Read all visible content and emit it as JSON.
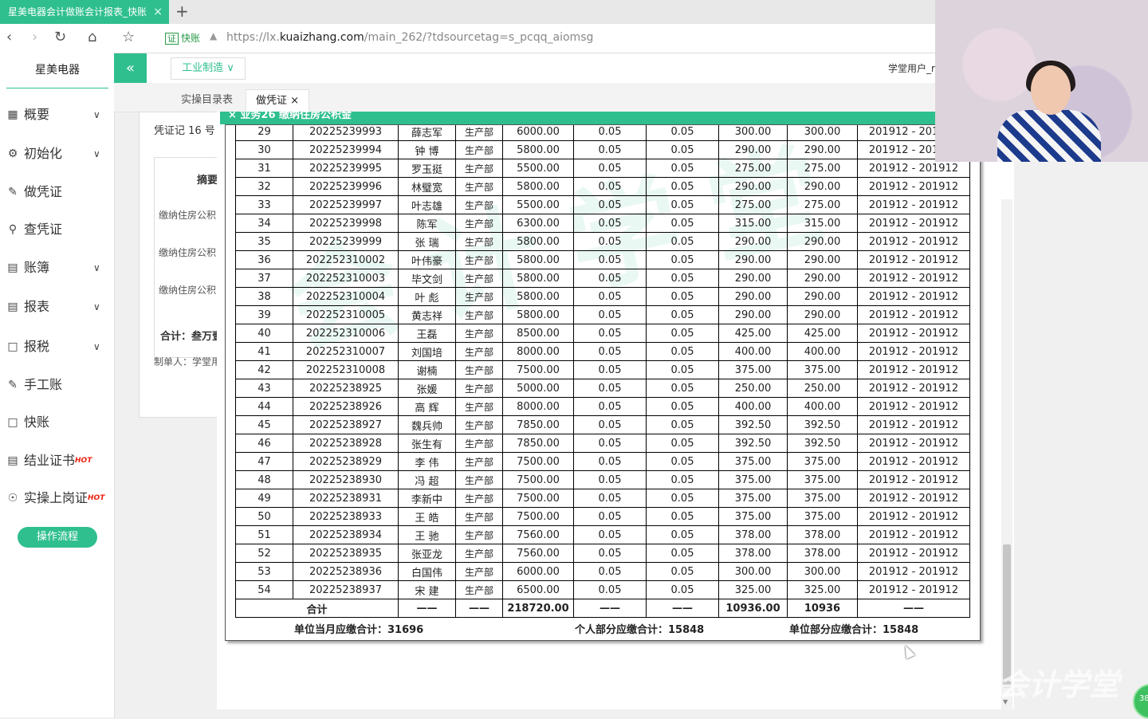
{
  "browser": {
    "tab_title": "星美电器会计做账会计报表_快账",
    "tab_close": "×",
    "new_tab": "+",
    "cert_badge": "证",
    "cert_name": "快账",
    "url_prefix": "https://lx.",
    "url_domain": "kuaizhang.com",
    "url_path": "/main_262/?tdsourcetag=s_pcqq_aiomsg"
  },
  "sidebar": {
    "company": "星美电器",
    "items": [
      {
        "label": "概要",
        "icon": "grid-icon",
        "chevron": true
      },
      {
        "label": "初始化",
        "icon": "gear-icon",
        "chevron": true
      },
      {
        "label": "做凭证",
        "icon": "pen-icon",
        "chevron": false
      },
      {
        "label": "查凭证",
        "icon": "search-icon",
        "chevron": false
      },
      {
        "label": "账簿",
        "icon": "book-icon",
        "chevron": true
      },
      {
        "label": "报表",
        "icon": "report-icon",
        "chevron": true
      },
      {
        "label": "报税",
        "icon": "document-icon",
        "chevron": true
      },
      {
        "label": "手工账",
        "icon": "pen-icon",
        "chevron": false
      },
      {
        "label": "快账",
        "icon": "document-icon",
        "chevron": false
      },
      {
        "label": "结业证书",
        "icon": "certificate-icon",
        "chevron": false,
        "hot": "HOT"
      },
      {
        "label": "实操上岗证",
        "icon": "medal-icon",
        "chevron": false,
        "hot": "HOT"
      }
    ],
    "flow_button": "操作流程"
  },
  "header": {
    "collapse": "«",
    "industry": "工业制造",
    "user": "学堂用户_r"
  },
  "page_tabs": [
    "实操目录表",
    "做凭证"
  ],
  "voucher": {
    "number": "凭证记 16 号",
    "summary_header": "摘要",
    "lines": [
      "缴纳住房公积",
      "缴纳住房公积",
      "缴纳住房公积"
    ],
    "total": "合计：叁万壹",
    "maker": "制单人：学堂用"
  },
  "modal": {
    "title": "× 业务26 缴纳住房公积金"
  },
  "table": {
    "rows": [
      [
        "29",
        "20225239993",
        "薛志军",
        "生产部",
        "6000.00",
        "0.05",
        "0.05",
        "300.00",
        "300.00",
        "201912 - 201912"
      ],
      [
        "30",
        "20225239994",
        "钟 博",
        "生产部",
        "5800.00",
        "0.05",
        "0.05",
        "290.00",
        "290.00",
        "201912 - 201912"
      ],
      [
        "31",
        "20225239995",
        "罗玉挺",
        "生产部",
        "5500.00",
        "0.05",
        "0.05",
        "275.00",
        "275.00",
        "201912 - 201912"
      ],
      [
        "32",
        "20225239996",
        "林璧宽",
        "生产部",
        "5800.00",
        "0.05",
        "0.05",
        "290.00",
        "290.00",
        "201912 - 201912"
      ],
      [
        "33",
        "20225239997",
        "叶志雄",
        "生产部",
        "5500.00",
        "0.05",
        "0.05",
        "275.00",
        "275.00",
        "201912 - 201912"
      ],
      [
        "34",
        "20225239998",
        "陈军",
        "生产部",
        "6300.00",
        "0.05",
        "0.05",
        "315.00",
        "315.00",
        "201912 - 201912"
      ],
      [
        "35",
        "20225239999",
        "张 瑞",
        "生产部",
        "5800.00",
        "0.05",
        "0.05",
        "290.00",
        "290.00",
        "201912 - 201912"
      ],
      [
        "36",
        "202252310002",
        "叶伟豪",
        "生产部",
        "5800.00",
        "0.05",
        "0.05",
        "290.00",
        "290.00",
        "201912 - 201912"
      ],
      [
        "37",
        "202252310003",
        "毕文剑",
        "生产部",
        "5800.00",
        "0.05",
        "0.05",
        "290.00",
        "290.00",
        "201912 - 201912"
      ],
      [
        "38",
        "202252310004",
        "叶 彪",
        "生产部",
        "5800.00",
        "0.05",
        "0.05",
        "290.00",
        "290.00",
        "201912 - 201912"
      ],
      [
        "39",
        "202252310005",
        "黄志祥",
        "生产部",
        "5800.00",
        "0.05",
        "0.05",
        "290.00",
        "290.00",
        "201912 - 201912"
      ],
      [
        "40",
        "202252310006",
        "王磊",
        "生产部",
        "8500.00",
        "0.05",
        "0.05",
        "425.00",
        "425.00",
        "201912 - 201912"
      ],
      [
        "41",
        "202252310007",
        "刘国培",
        "生产部",
        "8000.00",
        "0.05",
        "0.05",
        "400.00",
        "400.00",
        "201912 - 201912"
      ],
      [
        "42",
        "202252310008",
        "谢楠",
        "生产部",
        "7500.00",
        "0.05",
        "0.05",
        "375.00",
        "375.00",
        "201912 - 201912"
      ],
      [
        "43",
        "20225238925",
        "张媛",
        "生产部",
        "5000.00",
        "0.05",
        "0.05",
        "250.00",
        "250.00",
        "201912 - 201912"
      ],
      [
        "44",
        "20225238926",
        "高 辉",
        "生产部",
        "8000.00",
        "0.05",
        "0.05",
        "400.00",
        "400.00",
        "201912 - 201912"
      ],
      [
        "45",
        "20225238927",
        "魏兵帅",
        "生产部",
        "7850.00",
        "0.05",
        "0.05",
        "392.50",
        "392.50",
        "201912 - 201912"
      ],
      [
        "46",
        "20225238928",
        "张生有",
        "生产部",
        "7850.00",
        "0.05",
        "0.05",
        "392.50",
        "392.50",
        "201912 - 201912"
      ],
      [
        "47",
        "20225238929",
        "李 伟",
        "生产部",
        "7500.00",
        "0.05",
        "0.05",
        "375.00",
        "375.00",
        "201912 - 201912"
      ],
      [
        "48",
        "20225238930",
        "冯 超",
        "生产部",
        "7500.00",
        "0.05",
        "0.05",
        "375.00",
        "375.00",
        "201912 - 201912"
      ],
      [
        "49",
        "20225238931",
        "李新中",
        "生产部",
        "7500.00",
        "0.05",
        "0.05",
        "375.00",
        "375.00",
        "201912 - 201912"
      ],
      [
        "50",
        "20225238933",
        "王 皓",
        "生产部",
        "7500.00",
        "0.05",
        "0.05",
        "375.00",
        "375.00",
        "201912 - 201912"
      ],
      [
        "51",
        "20225238934",
        "王 驰",
        "生产部",
        "7560.00",
        "0.05",
        "0.05",
        "378.00",
        "378.00",
        "201912 - 201912"
      ],
      [
        "52",
        "20225238935",
        "张亚龙",
        "生产部",
        "7560.00",
        "0.05",
        "0.05",
        "378.00",
        "378.00",
        "201912 - 201912"
      ],
      [
        "53",
        "20225238936",
        "白国伟",
        "生产部",
        "6000.00",
        "0.05",
        "0.05",
        "300.00",
        "300.00",
        "201912 - 201912"
      ],
      [
        "54",
        "20225238937",
        "宋 建",
        "生产部",
        "6500.00",
        "0.05",
        "0.05",
        "325.00",
        "325.00",
        "201912 - 201912"
      ]
    ],
    "total_row": [
      "合计",
      "——",
      "——",
      "218720.00",
      "——",
      "——",
      "10936.00",
      "10936",
      "——"
    ]
  },
  "summary": {
    "company_month": "单位当月应缴合计：31696",
    "personal": "个人部分应缴合计：15848",
    "company_part": "单位部分应缴合计：15848"
  },
  "overlay": {
    "logo_text": "会计学堂",
    "badge": "38"
  },
  "colors": {
    "accent": "#2fbf8f"
  }
}
